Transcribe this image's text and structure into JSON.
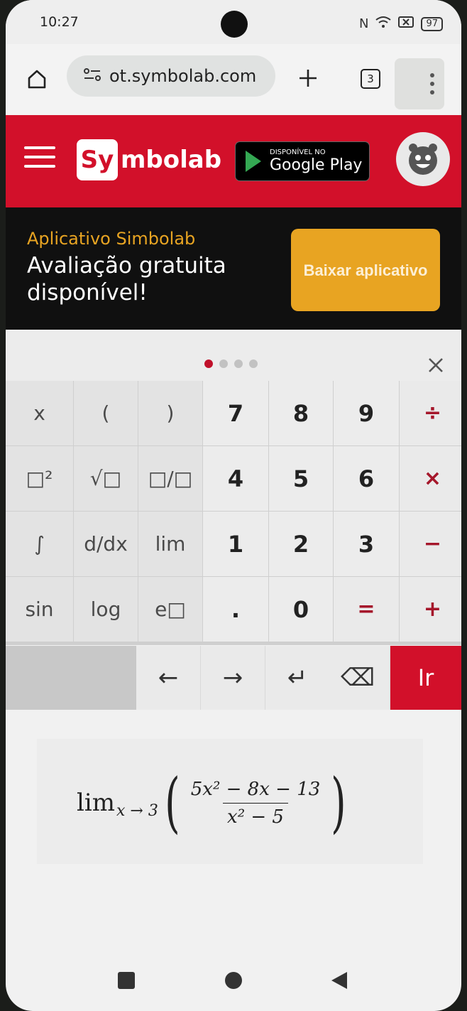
{
  "status_bar": {
    "time": "10:27",
    "battery": "97"
  },
  "browser": {
    "url": "ot.symbolab.com",
    "tab_count": "3"
  },
  "header": {
    "logo_box": "Sy",
    "logo_text": "mbolab",
    "store_small": "DISPONÍVEL NO",
    "store_big": "Google Play"
  },
  "promo": {
    "title": "Aplicativo Simbolab",
    "subtitle": "Avaliação gratuita disponível!",
    "button": "Baixar aplicativo"
  },
  "keypad": {
    "keys": [
      [
        "x",
        "(",
        ")",
        "7",
        "8",
        "9",
        "÷"
      ],
      [
        "□²",
        "√□",
        "□/□",
        "4",
        "5",
        "6",
        "×"
      ],
      [
        "∫",
        "d/dx",
        "lim",
        "1",
        "2",
        "3",
        "−"
      ],
      [
        "sin",
        "log",
        "e□",
        ".",
        "0",
        "=",
        "+"
      ]
    ]
  },
  "nav_keys": {
    "left": "←",
    "right": "→",
    "enter": "↵",
    "backspace": "⌫",
    "go": "Ir"
  },
  "expression": {
    "lim": "lim",
    "subscript": "x → 3",
    "numerator": "5x² − 8x − 13",
    "denominator": "x² − 5"
  },
  "icons": {
    "home": "home-icon",
    "url_settings": "page-settings-icon",
    "new_tab": "plus-icon",
    "tabs": "tabs-icon",
    "menu": "more-vert-icon",
    "hamburger": "hamburger-icon",
    "avatar": "avatar-icon",
    "close": "close-icon"
  },
  "colors": {
    "brand_red": "#d2102a",
    "accent_orange": "#e8a422"
  }
}
